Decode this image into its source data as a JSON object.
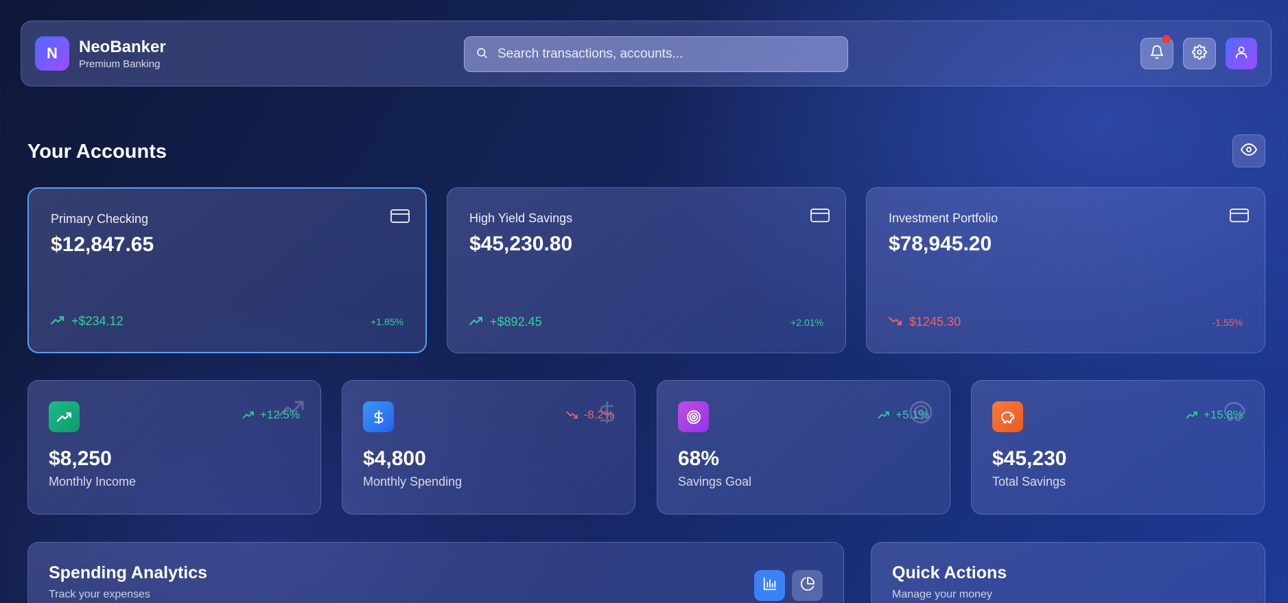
{
  "brand": {
    "logo_letter": "N",
    "name": "NeoBanker",
    "tagline": "Premium Banking"
  },
  "search": {
    "placeholder": "Search transactions, accounts..."
  },
  "header_icons": [
    "bell-icon",
    "gear-icon",
    "user-icon"
  ],
  "accounts_section": {
    "title": "Your Accounts"
  },
  "accounts": [
    {
      "name": "Primary Checking",
      "balance": "$12,847.65",
      "change": "+$234.12",
      "percent": "+1.85%",
      "trend": "up",
      "selected": true
    },
    {
      "name": "High Yield Savings",
      "balance": "$45,230.80",
      "change": "+$892.45",
      "percent": "+2.01%",
      "trend": "up",
      "selected": false
    },
    {
      "name": "Investment Portfolio",
      "balance": "$78,945.20",
      "change": "$1245.30",
      "percent": "-1.55%",
      "trend": "down",
      "selected": false
    }
  ],
  "stats": [
    {
      "value": "$8,250",
      "label": "Monthly Income",
      "change": "+12.5%",
      "trend": "up",
      "icon": "trending-up-icon",
      "color": "#1fb985"
    },
    {
      "value": "$4,800",
      "label": "Monthly Spending",
      "change": "-8.2%",
      "trend": "down",
      "icon": "dollar-icon",
      "color": "#2f8cf5"
    },
    {
      "value": "68%",
      "label": "Savings Goal",
      "change": "+5.1%",
      "trend": "up",
      "icon": "target-icon",
      "color": "#b04ee0"
    },
    {
      "value": "$45,230",
      "label": "Total Savings",
      "change": "+15.8%",
      "trend": "up",
      "icon": "piggy-bank-icon",
      "color": "#f26a2f"
    }
  ],
  "analytics": {
    "title": "Spending Analytics",
    "subtitle": "Track your expenses"
  },
  "quick_actions": {
    "title": "Quick Actions",
    "subtitle": "Manage your money"
  },
  "colors": {
    "positive": "#34d39a",
    "negative": "#f2636a",
    "accent": "#3b82f6",
    "notification": "#ef3b3b"
  }
}
